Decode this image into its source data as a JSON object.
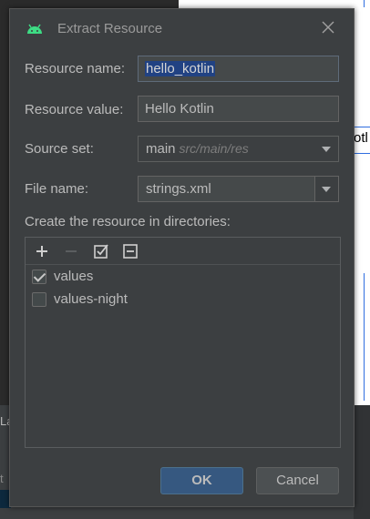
{
  "background": {
    "editor_fragment_text": "otl",
    "bottom_tab_text": "La",
    "bottom_line_text": "t"
  },
  "dialog": {
    "title": "Extract Resource",
    "icons": {
      "app": "android-icon",
      "close": "close-icon"
    },
    "fields": {
      "resource_name": {
        "label": "Resource name:",
        "value": "hello_kotlin"
      },
      "resource_value": {
        "label": "Resource value:",
        "value": "Hello Kotlin"
      },
      "source_set": {
        "label": "Source set:",
        "value": "main",
        "hint": "src/main/res"
      },
      "file_name": {
        "label": "File name:",
        "value": "strings.xml"
      }
    },
    "directories": {
      "label": "Create the resource in directories:",
      "toolbar": [
        "add-icon",
        "remove-icon",
        "check-all-icon",
        "uncheck-all-icon"
      ],
      "items": [
        {
          "label": "values",
          "checked": true
        },
        {
          "label": "values-night",
          "checked": false
        }
      ]
    },
    "buttons": {
      "ok": "OK",
      "cancel": "Cancel"
    }
  },
  "colors": {
    "dialog_bg": "#3c3f41",
    "primary_button": "#365880",
    "selection": "#214283",
    "android_green": "#3ddc84"
  }
}
